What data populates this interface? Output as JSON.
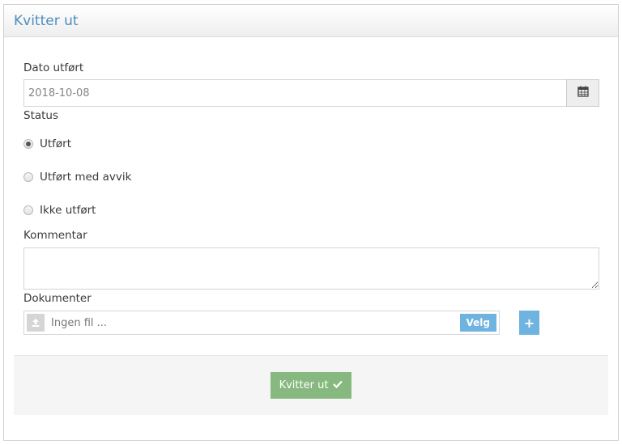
{
  "panel": {
    "title": "Kvitter ut"
  },
  "date": {
    "label": "Dato utført",
    "value": "2018-10-08",
    "icon": "calendar-icon"
  },
  "status": {
    "label": "Status",
    "options": [
      {
        "label": "Utført",
        "checked": true
      },
      {
        "label": "Utført med avvik",
        "checked": false
      },
      {
        "label": "Ikke utført",
        "checked": false
      }
    ]
  },
  "comment": {
    "label": "Kommentar",
    "value": ""
  },
  "documents": {
    "label": "Dokumenter",
    "file_placeholder": "Ingen fil ...",
    "choose_label": "Velg",
    "add_label": "+",
    "upload_icon": "upload-icon"
  },
  "footer": {
    "submit_label": "Kvitter ut",
    "submit_icon": "check-icon"
  },
  "colors": {
    "title": "#4c8fbd",
    "accent_blue": "#6fb3e0",
    "submit_green": "#87b87f"
  }
}
